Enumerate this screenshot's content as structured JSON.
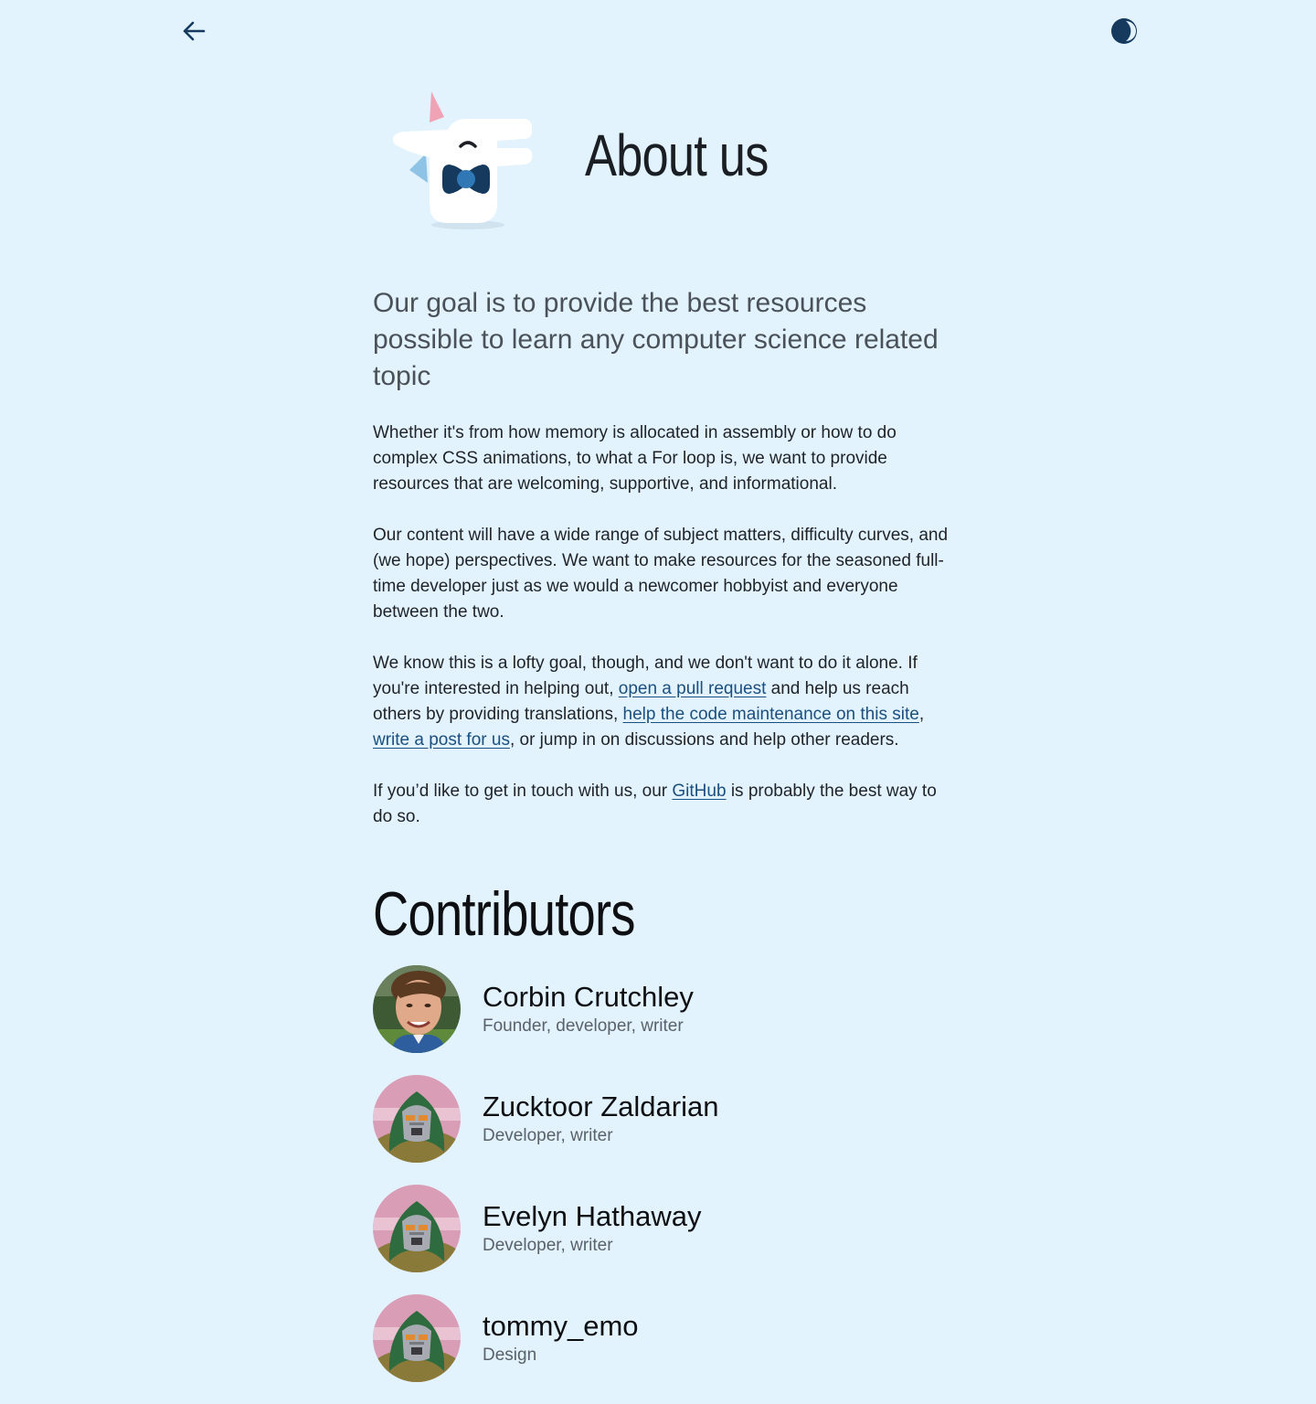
{
  "nav": {
    "back_icon": "arrow-left-icon",
    "theme_icon": "half-moon-icon"
  },
  "header": {
    "title": "About us",
    "logo_icon": "unicorn-bowtie-logo"
  },
  "intro": {
    "lead": "Our goal is to provide the best resources possible to learn any computer science related topic",
    "p1": "Whether it's from how memory is allocated in assembly or how to do complex CSS animations, to what a For loop is, we want to provide resources that are welcoming, supportive, and informational.",
    "p2": "Our content will have a wide range of subject matters, difficulty curves, and (we hope) perspectives. We want to make resources for the seasoned full-time developer just as we would a newcomer hobbyist and everyone between the two.",
    "p3": {
      "t1": "We know this is a lofty goal, though, and we don't want to do it alone. If you're interested in helping out, ",
      "link1": "open a pull request",
      "t2": " and help us reach others by providing translations, ",
      "link2": "help the code maintenance on this site",
      "t3": ", ",
      "link3": "write a post for us",
      "t4": ", or jump in on discussions and help other readers."
    },
    "p4": {
      "t1": "If you’d like to get in touch with us, our ",
      "link": "GitHub",
      "t2": " is probably the best way to do so."
    }
  },
  "contributors": {
    "title": "Contributors",
    "people": [
      {
        "name": "Corbin Crutchley",
        "role": "Founder, developer, writer"
      },
      {
        "name": "Zucktoor Zaldarian",
        "role": "Developer, writer"
      },
      {
        "name": "Evelyn Hathaway",
        "role": "Developer, writer"
      },
      {
        "name": "tommy_emo",
        "role": "Design"
      }
    ]
  },
  "colors": {
    "background": "#e2f3fe",
    "link": "#1b4f80",
    "icon": "#153a5e"
  }
}
